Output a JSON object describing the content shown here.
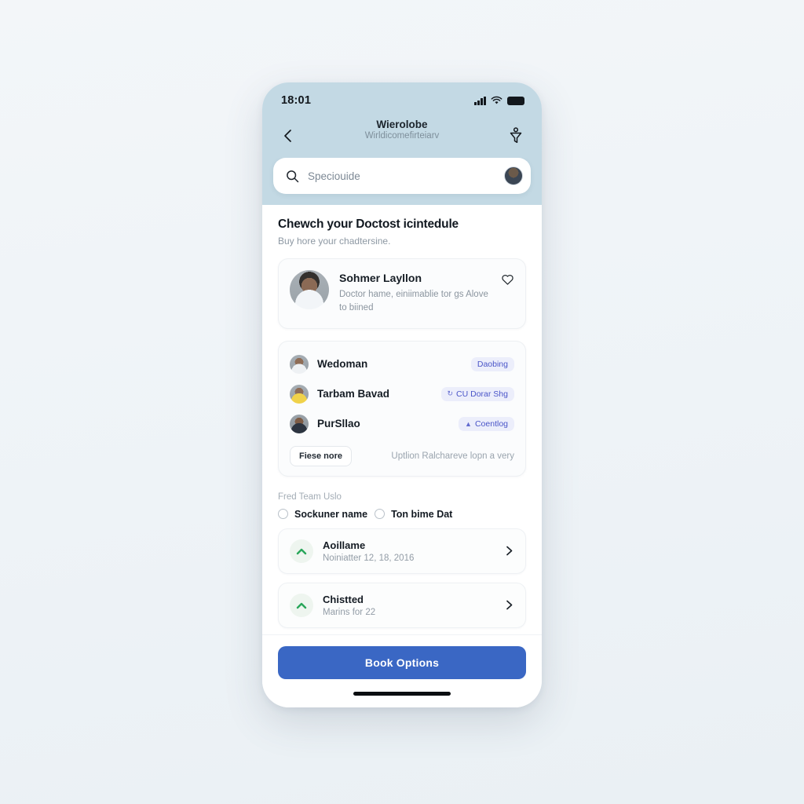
{
  "status_bar": {
    "time": "18:01",
    "signal_icon": "cellular-bars-icon",
    "wifi_icon": "wifi-icon",
    "battery_icon": "battery-full-icon"
  },
  "header": {
    "back_icon": "chevron-left-icon",
    "title": "Wierolobe",
    "subtitle": "Wirldicomefirteiarv",
    "action_icon": "filter-funnel-icon"
  },
  "search": {
    "icon": "search-icon",
    "placeholder": "Speciouide",
    "value": "",
    "avatar_icon": "user-avatar"
  },
  "section": {
    "title": "Chewch your Doctost icintedule",
    "subtitle": "Buy hore your chadtersine."
  },
  "featured_doctor": {
    "avatar_icon": "doctor-avatar",
    "name": "Sohmer Layllon",
    "description": "Doctor hame, einiimablie tor gs Alove to biined",
    "favorite_icon": "heart-outline-icon"
  },
  "doctor_list": {
    "rows": [
      {
        "avatar_icon": "user-avatar",
        "name": "Wedoman",
        "badge": "Daobing",
        "badge_glyph": ""
      },
      {
        "avatar_icon": "user-avatar",
        "name": "Tarbam Bavad",
        "badge": "CU Dorar Shg",
        "badge_glyph": "↻"
      },
      {
        "avatar_icon": "user-avatar",
        "name": "PurSllao",
        "badge": "Coentlog",
        "badge_glyph": "▲"
      }
    ],
    "more_button": "Fiese nore",
    "footnote": "Uptlion Ralchareve lopn a very"
  },
  "options": {
    "label": "Fred Team Uslo",
    "radios": [
      {
        "label": "Sockuner name",
        "selected": false
      },
      {
        "label": "Ton bime Dat",
        "selected": false
      }
    ]
  },
  "results": [
    {
      "icon": "chevron-up-green-icon",
      "title": "Aoillame",
      "subtitle": "Noiniatter 12, 18, 2016",
      "chevron_icon": "chevron-right-icon"
    },
    {
      "icon": "chevron-up-green-icon",
      "title": "Chistted",
      "subtitle": "Marins for 22",
      "chevron_icon": "chevron-right-icon"
    }
  ],
  "footer": {
    "cta_label": "Book Options",
    "home_indicator": "home-indicator"
  },
  "colors": {
    "header_bg": "#c3d9e4",
    "page_bg": "#f1f5f8",
    "accent_blue": "#3a67c4",
    "badge_text": "#4a55c8",
    "badge_bg": "#eceefb",
    "green": "#29a65a"
  }
}
